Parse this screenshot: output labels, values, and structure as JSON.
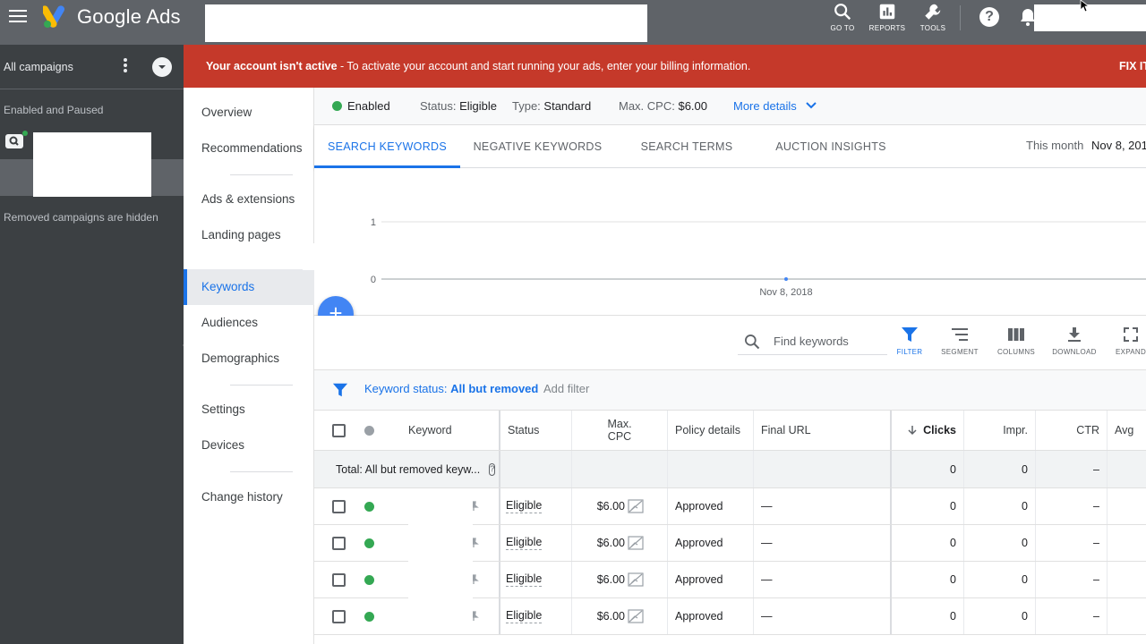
{
  "app": {
    "title": "Google Ads"
  },
  "topbar": {
    "tools": [
      {
        "label": "GO TO",
        "icon": "search-icon"
      },
      {
        "label": "REPORTS",
        "icon": "reports-icon"
      },
      {
        "label": "TOOLS",
        "icon": "wrench-icon"
      }
    ],
    "help_icon": "help-icon",
    "bell_icon": "notifications-icon"
  },
  "sidebar": {
    "all_campaigns": "All campaigns",
    "status_filter": "Enabled and Paused",
    "hidden_note": "Removed campaigns are hidden"
  },
  "alert": {
    "bold": "Your account isn't active",
    "text": " - To activate your account and start running your ads, enter your billing information.",
    "action": "FIX IT"
  },
  "pagenav": {
    "items": [
      {
        "label": "Overview"
      },
      {
        "label": "Recommendations"
      },
      {
        "label": "Ads & extensions"
      },
      {
        "label": "Landing pages"
      },
      {
        "label": "Keywords"
      },
      {
        "label": "Audiences"
      },
      {
        "label": "Demographics"
      },
      {
        "label": "Settings"
      },
      {
        "label": "Devices"
      },
      {
        "label": "Change history"
      }
    ],
    "active": "Keywords"
  },
  "infobar": {
    "enabled": "Enabled",
    "status_label": "Status:",
    "status_value": "Eligible",
    "type_label": "Type:",
    "type_value": "Standard",
    "cpc_label": "Max. CPC:",
    "cpc_value": "$6.00",
    "more": "More details"
  },
  "tabs": {
    "items": [
      "SEARCH KEYWORDS",
      "NEGATIVE KEYWORDS",
      "SEARCH TERMS",
      "AUCTION INSIGHTS"
    ],
    "active": "SEARCH KEYWORDS",
    "range_label": "This month",
    "range_value": "Nov 8, 201"
  },
  "chart_data": {
    "type": "line",
    "x": [
      "Nov 8, 2018"
    ],
    "series": [
      {
        "values": [
          0
        ]
      }
    ],
    "yticks": [
      0,
      1
    ],
    "ylim": [
      0,
      2
    ],
    "grid": true
  },
  "toolbar": {
    "search_placeholder": "Find keywords",
    "buttons": [
      {
        "label": "FILTER",
        "icon": "filter-icon"
      },
      {
        "label": "SEGMENT",
        "icon": "segment-icon"
      },
      {
        "label": "COLUMNS",
        "icon": "columns-icon"
      },
      {
        "label": "DOWNLOAD",
        "icon": "download-icon"
      },
      {
        "label": "EXPAND",
        "icon": "expand-icon"
      }
    ]
  },
  "filter": {
    "label": "Keyword status: ",
    "value": "All but removed",
    "add": "Add filter"
  },
  "table": {
    "headers": {
      "keyword": "Keyword",
      "status": "Status",
      "max_cpc_1": "Max.",
      "max_cpc_2": "CPC",
      "policy": "Policy details",
      "final_url": "Final URL",
      "clicks": "Clicks",
      "impr": "Impr.",
      "ctr": "CTR",
      "avg": "Avg"
    },
    "total": {
      "label": "Total: All but removed keyw...",
      "clicks": "0",
      "impr": "0",
      "ctr": "–"
    },
    "rows": [
      {
        "status": "Eligible",
        "cpc": "$6.00",
        "policy": "Approved",
        "url": "—",
        "clicks": "0",
        "impr": "0",
        "ctr": "–"
      },
      {
        "status": "Eligible",
        "cpc": "$6.00",
        "policy": "Approved",
        "url": "—",
        "clicks": "0",
        "impr": "0",
        "ctr": "–"
      },
      {
        "status": "Eligible",
        "cpc": "$6.00",
        "policy": "Approved",
        "url": "—",
        "clicks": "0",
        "impr": "0",
        "ctr": "–"
      },
      {
        "status": "Eligible",
        "cpc": "$6.00",
        "policy": "Approved",
        "url": "—",
        "clicks": "0",
        "impr": "0",
        "ctr": "–"
      }
    ]
  },
  "colors": {
    "topbar": "#5f6368",
    "sidebar": "#3c4043",
    "alert": "#c5392a",
    "accent": "#1a73e8",
    "enabled": "#34a853"
  }
}
